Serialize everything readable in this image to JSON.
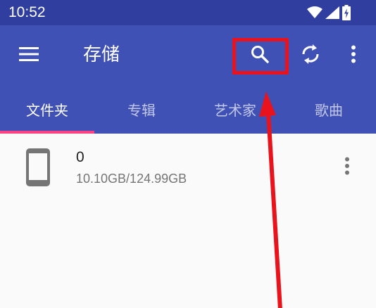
{
  "status_bar": {
    "time": "10:52",
    "icons": [
      "wifi-icon",
      "cell-signal-icon",
      "battery-charging-icon"
    ]
  },
  "toolbar": {
    "title": "存储",
    "icons": [
      "menu-icon",
      "search-icon",
      "refresh-icon",
      "more-vert-icon"
    ],
    "color": "#3f51b5"
  },
  "tabs": [
    {
      "label": "文件夹",
      "active": true
    },
    {
      "label": "专辑",
      "active": false
    },
    {
      "label": "艺术家",
      "active": false
    },
    {
      "label": "歌曲",
      "active": false
    }
  ],
  "storage_list": [
    {
      "icon": "phone-icon",
      "title": "0",
      "usage": "10.10GB/124.99GB"
    }
  ],
  "colors": {
    "status_bar": "#303f9f",
    "accent": "#ff4081",
    "annotation": "#e8131c"
  }
}
